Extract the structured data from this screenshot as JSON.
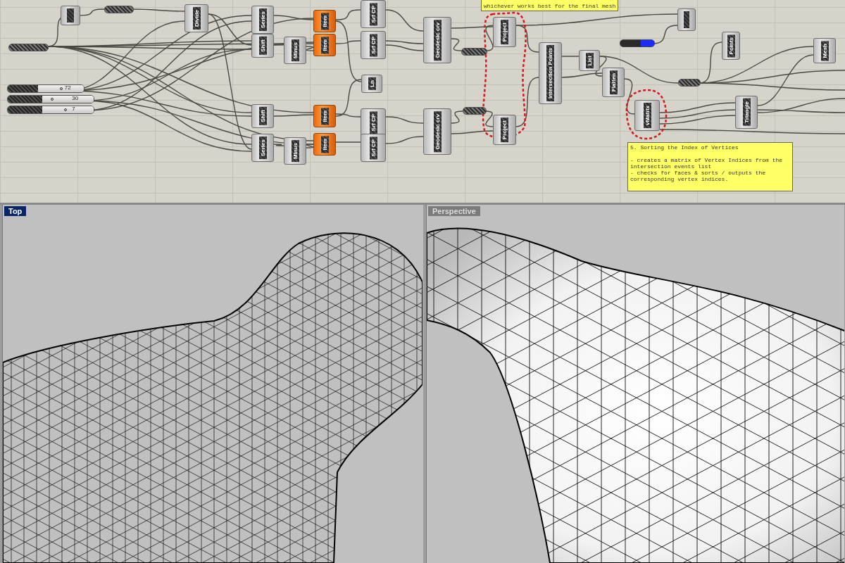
{
  "canvas": {
    "components": [
      {
        "label": "Divide",
        "kind": "component"
      },
      {
        "label": "Series",
        "kind": "component"
      },
      {
        "label": "Srf CP",
        "kind": "component"
      },
      {
        "label": "Item",
        "kind": "item"
      },
      {
        "label": "Item",
        "kind": "item"
      },
      {
        "label": "Shift",
        "kind": "component"
      },
      {
        "label": "Minus",
        "kind": "component"
      },
      {
        "label": "Srf CP",
        "kind": "component"
      },
      {
        "label": "Geodesic crv",
        "kind": "component"
      },
      {
        "label": "Project",
        "kind": "component"
      },
      {
        "label": "Intersection Points",
        "kind": "component"
      },
      {
        "label": "List",
        "kind": "component"
      },
      {
        "label": "Flatten",
        "kind": "component"
      },
      {
        "label": "Points",
        "kind": "component"
      },
      {
        "label": "Mesh",
        "kind": "component"
      },
      {
        "label": "Ln",
        "kind": "component"
      },
      {
        "label": "vMatrix",
        "kind": "component"
      },
      {
        "label": "Triangle",
        "kind": "component"
      },
      {
        "label": "Shift",
        "kind": "component"
      },
      {
        "label": "Item",
        "kind": "item"
      },
      {
        "label": "Srf CP",
        "kind": "component"
      },
      {
        "label": "Geodesic crv",
        "kind": "component"
      },
      {
        "label": "Project",
        "kind": "component"
      },
      {
        "label": "Series",
        "kind": "component"
      },
      {
        "label": "Minus",
        "kind": "component"
      },
      {
        "label": "Item",
        "kind": "item"
      },
      {
        "label": "Srf CP",
        "kind": "component"
      }
    ],
    "sliders": [
      {
        "value": "72",
        "level": 0.5
      },
      {
        "value": "30",
        "level": 0.2
      },
      {
        "value": "7",
        "level": 0.45
      }
    ],
    "notes": [
      {
        "lines": [
          "whichever works best for the final mesh"
        ]
      },
      {
        "lines": [
          "5. Sorting the Index of Vertices",
          "- creates a matrix of Vertex Indices from the",
          "intersection events list",
          "- checks for faces & sorts / outputs the",
          "corresponding vertex indices."
        ]
      }
    ]
  },
  "viewports": [
    {
      "title": "Top",
      "selected": true
    },
    {
      "title": "Perspective",
      "selected": false
    }
  ]
}
